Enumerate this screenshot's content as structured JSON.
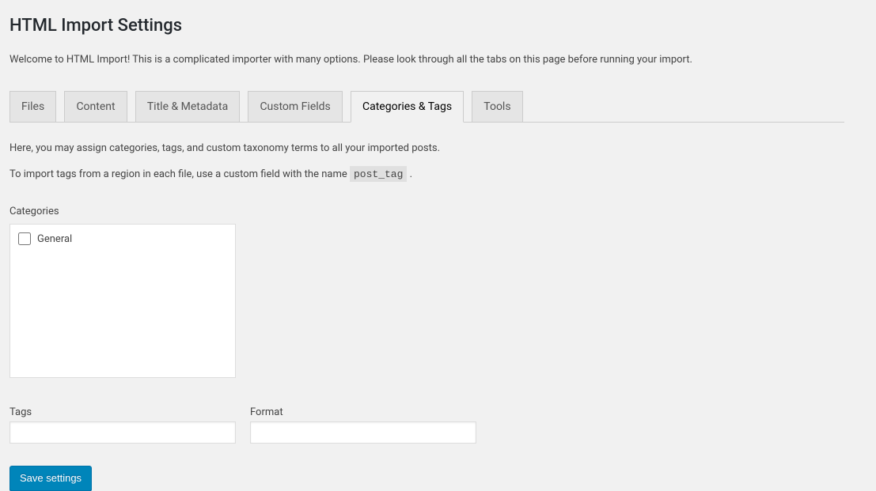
{
  "page": {
    "title": "HTML Import Settings",
    "intro": "Welcome to HTML Import! This is a complicated importer with many options. Please look through all the tabs on this page before running your import."
  },
  "tabs": [
    {
      "label": "Files",
      "active": false
    },
    {
      "label": "Content",
      "active": false
    },
    {
      "label": "Title & Metadata",
      "active": false
    },
    {
      "label": "Custom Fields",
      "active": false
    },
    {
      "label": "Categories & Tags",
      "active": true
    },
    {
      "label": "Tools",
      "active": false
    }
  ],
  "content": {
    "desc1": "Here, you may assign categories, tags, and custom taxonomy terms to all your imported posts.",
    "desc2_prefix": "To import tags from a region in each file, use a custom field with the name ",
    "desc2_code": "post_tag",
    "desc2_suffix": " ."
  },
  "categories": {
    "label": "Categories",
    "items": [
      {
        "label": "General",
        "checked": false
      }
    ]
  },
  "fields": {
    "tags_label": "Tags",
    "tags_value": "",
    "format_label": "Format",
    "format_value": ""
  },
  "actions": {
    "save_label": "Save settings"
  }
}
